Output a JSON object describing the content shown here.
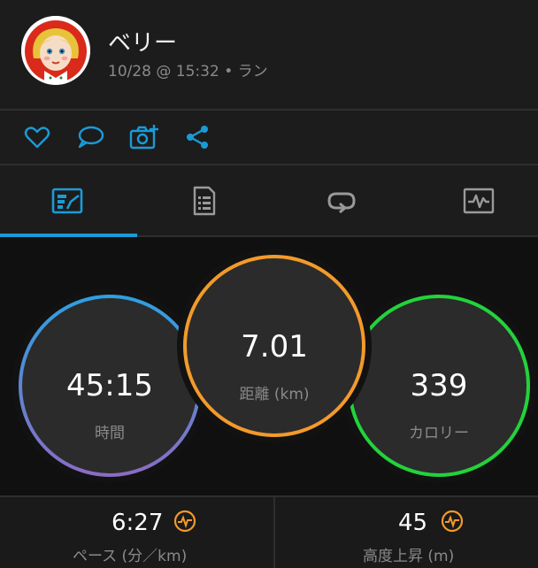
{
  "activity": {
    "user_name": "ベリー",
    "meta": "10/28 @ 15:32 • ラン"
  },
  "actions": {
    "items": [
      {
        "icon": "heart-icon"
      },
      {
        "icon": "comment-icon"
      },
      {
        "icon": "add-photo-icon"
      },
      {
        "icon": "share-icon"
      }
    ]
  },
  "tabs": {
    "items": [
      {
        "icon": "stats-overview-icon",
        "active": true
      },
      {
        "icon": "details-document-icon",
        "active": false
      },
      {
        "icon": "laps-icon",
        "active": false
      },
      {
        "icon": "chart-icon",
        "active": false
      }
    ]
  },
  "stats": {
    "time": {
      "value": "45:15",
      "label": "時間"
    },
    "distance": {
      "value": "7.01",
      "label": "距離 (km)"
    },
    "calories": {
      "value": "339",
      "label": "カロリー"
    }
  },
  "bottom": {
    "pace": {
      "value": "6:27",
      "label": "ペース (分／km)"
    },
    "elevation": {
      "value": "45",
      "label": "高度上昇 (m)"
    }
  },
  "colors": {
    "accent": "#1a9bd7",
    "distance_ring": "#f39a2b",
    "calories_ring": "#22d33b",
    "time_ring_start": "#2f9fe0",
    "time_ring_end": "#8b6cc4"
  }
}
